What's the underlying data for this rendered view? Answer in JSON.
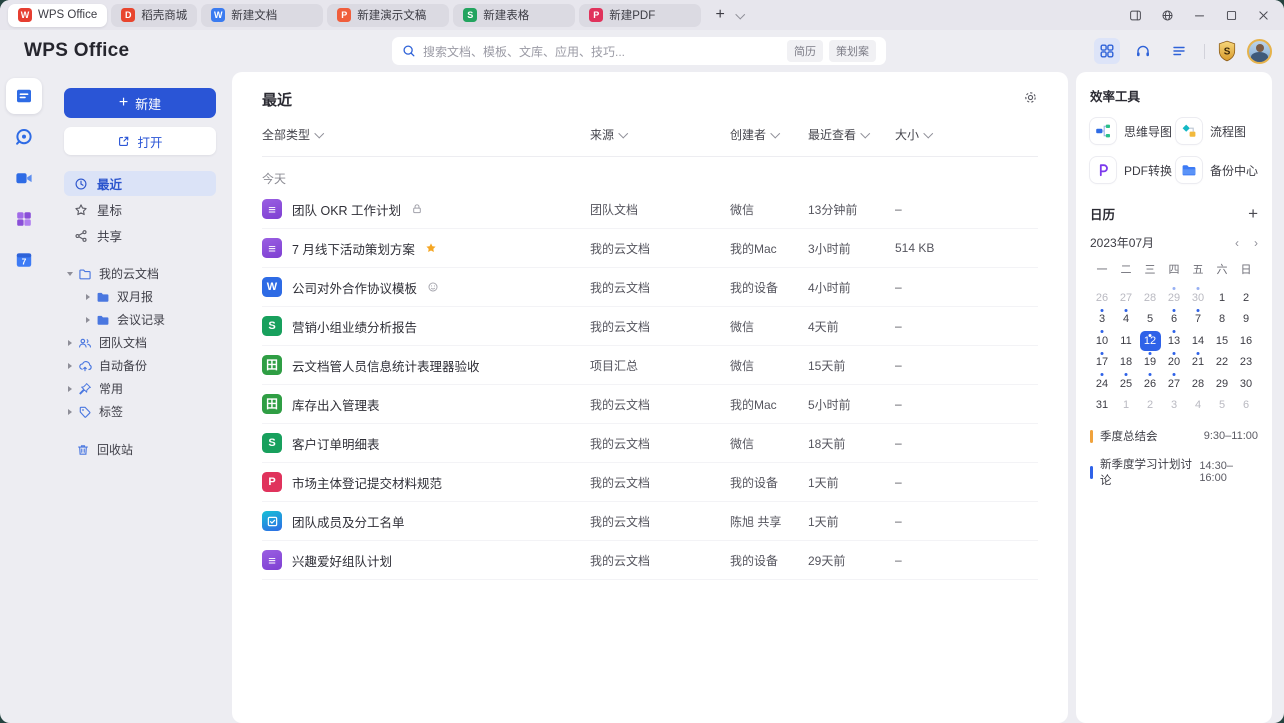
{
  "colors": {
    "accent_blue": "#2e62d8",
    "new_button_blue": "#2a55d6",
    "selected_day_blue": "#2f62e8",
    "event_orange": "#f0a23c",
    "event_blue": "#2f62e8",
    "star_gold": "#f5a623"
  },
  "tab_bar": {
    "tabs": [
      {
        "label": "WPS Office",
        "icon": "wps-logo",
        "letter": "W",
        "color": "#e63e31",
        "active": true,
        "wide": false
      },
      {
        "label": "稻壳商城",
        "icon": "docer",
        "letter": "D",
        "color": "#e8452e",
        "active": false,
        "wide": false
      },
      {
        "label": "新建文档",
        "icon": "writer",
        "letter": "W",
        "color": "#3a7bf0",
        "active": false,
        "wide": true
      },
      {
        "label": "新建演示文稿",
        "icon": "presentation",
        "letter": "P",
        "color": "#f05e3c",
        "active": false,
        "wide": true
      },
      {
        "label": "新建表格",
        "icon": "spreadsheet",
        "letter": "S",
        "color": "#23a45f",
        "active": false,
        "wide": true
      },
      {
        "label": "新建PDF",
        "icon": "pdf",
        "letter": "P",
        "color": "#e0335c",
        "active": false,
        "wide": true
      }
    ],
    "new_tab_label": "+",
    "window_controls": [
      "side-panel-toggle-icon",
      "globe-icon",
      "minimize-icon",
      "maximize-icon",
      "close-icon"
    ]
  },
  "header": {
    "logo": "WPS Office",
    "search": {
      "placeholder": "搜索文档、模板、文库、应用、技巧...",
      "tags": [
        "简历",
        "策划案"
      ]
    },
    "right_icons": [
      "apps-grid-icon",
      "headset-icon",
      "menu-icon",
      "vip-shield-badge",
      "avatar"
    ]
  },
  "rail": {
    "items": [
      "documents-icon",
      "messages-icon",
      "meeting-icon",
      "apps-icon",
      "calendar-icon"
    ]
  },
  "sidebar": {
    "new_label": "新建",
    "open_label": "打开",
    "nav": [
      {
        "label": "最近",
        "icon": "clock",
        "active": true
      },
      {
        "label": "星标",
        "icon": "star-o",
        "active": false
      },
      {
        "label": "共享",
        "icon": "share",
        "active": false
      }
    ],
    "tree": [
      {
        "label": "我的云文档",
        "icon": "folder-o",
        "caret": "down",
        "level": 0
      },
      {
        "label": "双月报",
        "icon": "folder-f",
        "caret": "right",
        "level": 1
      },
      {
        "label": "会议记录",
        "icon": "folder-f",
        "caret": "right",
        "level": 1
      },
      {
        "label": "团队文档",
        "icon": "team",
        "caret": "right",
        "level": 0
      },
      {
        "label": "自动备份",
        "icon": "cloud",
        "caret": "right",
        "level": 0
      },
      {
        "label": "常用",
        "icon": "pin",
        "caret": "right",
        "level": 0
      },
      {
        "label": "标签",
        "icon": "tag",
        "caret": "right",
        "level": 0
      }
    ],
    "trash_label": "回收站"
  },
  "main": {
    "title": "最近",
    "settings_icon": "gear-icon",
    "filters": [
      "全部类型",
      "来源",
      "创建者",
      "最近查看",
      "大小"
    ],
    "group_label": "今天",
    "files": [
      {
        "name": "团队 OKR 工作计划",
        "type": "doc",
        "badges": [
          "lock",
          "people"
        ],
        "source": "团队文档",
        "creator": "微信",
        "viewed": "13分钟前",
        "size": "–"
      },
      {
        "name": "7 月线下活动策划方案",
        "type": "doc",
        "badges": [
          "star"
        ],
        "source": "我的云文档",
        "creator": "我的Mac",
        "viewed": "3小时前",
        "size": "514 KB"
      },
      {
        "name": "公司对外合作协议模板",
        "type": "word",
        "badges": [
          "smile"
        ],
        "source": "我的云文档",
        "creator": "我的设备",
        "viewed": "4小时前",
        "size": "–"
      },
      {
        "name": "营销小组业绩分析报告",
        "type": "sheet",
        "badges": [],
        "source": "我的云文档",
        "creator": "微信",
        "viewed": "4天前",
        "size": "–"
      },
      {
        "name": "云文档管人员信息统计表理器验收",
        "type": "grid",
        "badges": [],
        "source": "项目汇总",
        "creator": "微信",
        "viewed": "15天前",
        "size": "–"
      },
      {
        "name": "库存出入管理表",
        "type": "grid",
        "badges": [
          "people"
        ],
        "source": "我的云文档",
        "creator": "我的Mac",
        "viewed": "5小时前",
        "size": "–"
      },
      {
        "name": "客户订单明细表",
        "type": "sheet",
        "badges": [],
        "source": "我的云文档",
        "creator": "微信",
        "viewed": "18天前",
        "size": "–"
      },
      {
        "name": "市场主体登记提交材料规范",
        "type": "pdf",
        "badges": [
          "people"
        ],
        "source": "我的云文档",
        "creator": "我的设备",
        "viewed": "1天前",
        "size": "–"
      },
      {
        "name": "团队成员及分工名单",
        "type": "form",
        "badges": [
          "people"
        ],
        "source": "我的云文档",
        "creator": "陈旭 共享",
        "viewed": "1天前",
        "size": "–"
      },
      {
        "name": "兴趣爱好组队计划",
        "type": "doc",
        "badges": [
          "people"
        ],
        "source": "我的云文档",
        "creator": "我的设备",
        "viewed": "29天前",
        "size": "–"
      }
    ]
  },
  "tools": {
    "title": "效率工具",
    "items": [
      {
        "label": "思维导图",
        "icon": "mindmap"
      },
      {
        "label": "流程图",
        "icon": "flow"
      },
      {
        "label": "PDF转换",
        "icon": "pdfconv"
      },
      {
        "label": "备份中心",
        "icon": "backup"
      }
    ]
  },
  "calendar": {
    "title": "日历",
    "add_label": "+",
    "month": "2023年07月",
    "prev_arrow": "‹",
    "next_arrow": "›",
    "weekdays": [
      "一",
      "二",
      "三",
      "四",
      "五",
      "六",
      "日"
    ],
    "days": [
      {
        "d": 26,
        "muted": true
      },
      {
        "d": 27,
        "muted": true
      },
      {
        "d": 28,
        "muted": true
      },
      {
        "d": 29,
        "muted": true,
        "dot": true
      },
      {
        "d": 30,
        "muted": true,
        "dot": true
      },
      {
        "d": 1
      },
      {
        "d": 2
      },
      {
        "d": 3,
        "dot": true
      },
      {
        "d": 4,
        "dot": true
      },
      {
        "d": 5
      },
      {
        "d": 6,
        "dot": true
      },
      {
        "d": 7,
        "dot": true
      },
      {
        "d": 8
      },
      {
        "d": 9
      },
      {
        "d": 10,
        "dot": true
      },
      {
        "d": 11
      },
      {
        "d": 12,
        "sel": true,
        "dot": true
      },
      {
        "d": 13,
        "dot": true
      },
      {
        "d": 14
      },
      {
        "d": 15
      },
      {
        "d": 16
      },
      {
        "d": 17,
        "dot": true
      },
      {
        "d": 18
      },
      {
        "d": 19,
        "dot": true
      },
      {
        "d": 20,
        "dot": true
      },
      {
        "d": 21,
        "dot": true
      },
      {
        "d": 22
      },
      {
        "d": 23
      },
      {
        "d": 24,
        "dot": true
      },
      {
        "d": 25,
        "dot": true
      },
      {
        "d": 26,
        "dot": true
      },
      {
        "d": 27,
        "dot": true
      },
      {
        "d": 28
      },
      {
        "d": 29
      },
      {
        "d": 30
      },
      {
        "d": 31
      },
      {
        "d": 1,
        "muted": true
      },
      {
        "d": 2,
        "muted": true
      },
      {
        "d": 3,
        "muted": true
      },
      {
        "d": 4,
        "muted": true
      },
      {
        "d": 5,
        "muted": true
      },
      {
        "d": 6,
        "muted": true
      }
    ],
    "events": [
      {
        "label": "季度总结会",
        "time": "9:30–11:00",
        "color": "#f0a23c"
      },
      {
        "label": "新季度学习计划讨论",
        "time": "14:30–16:00",
        "color": "#2f62e8"
      }
    ]
  }
}
